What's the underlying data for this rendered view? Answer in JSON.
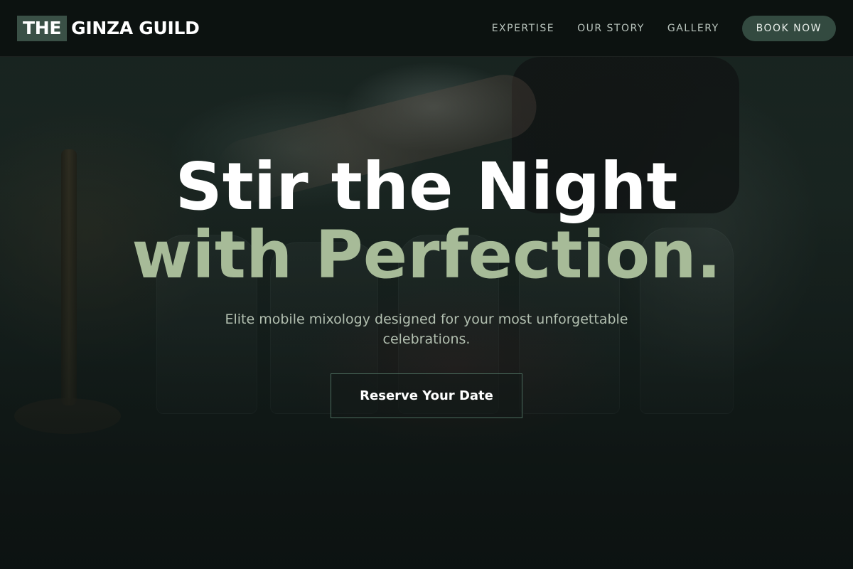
{
  "header": {
    "logo_mark": "THE",
    "logo_text": "GINZA GUILD",
    "nav": [
      "EXPERTISE",
      "OUR STORY",
      "GALLERY"
    ],
    "cta_label": "BOOK NOW"
  },
  "hero": {
    "headline_line1": "Stir the Night",
    "headline_line2": "with Perfection.",
    "subtitle": "Elite mobile mixology designed for your most unforgettable celebrations.",
    "cta_label": "Reserve Your Date"
  },
  "colors": {
    "accent_green": "#334a40",
    "headline_sage": "#a7bb98",
    "background": "#0d1311"
  }
}
